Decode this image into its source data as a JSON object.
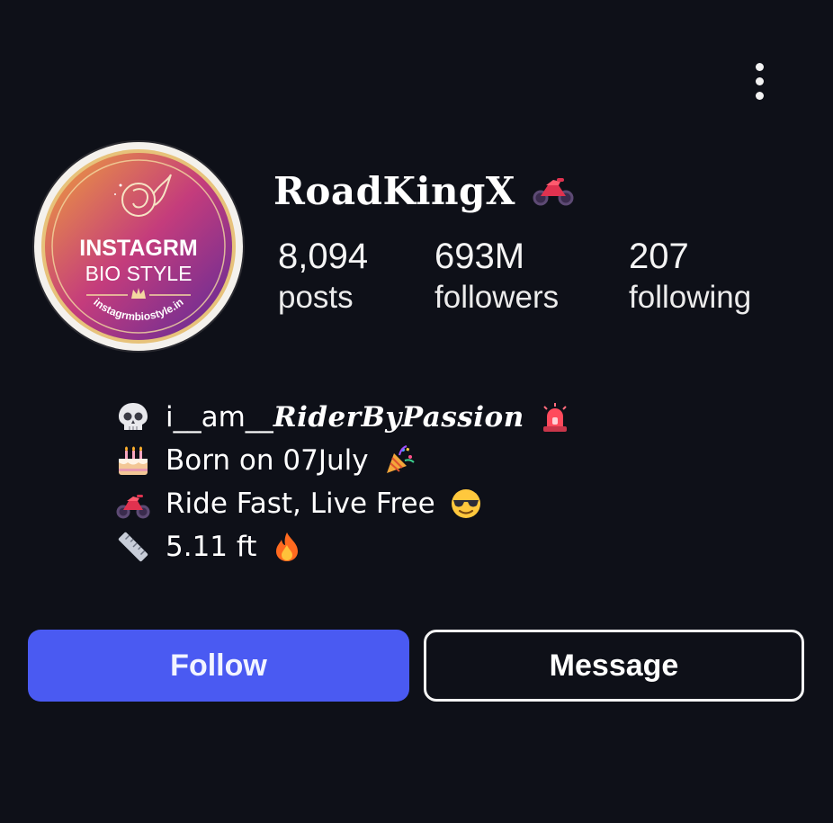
{
  "profile": {
    "username": "RoadKingX",
    "username_icon": "motorcycle-icon",
    "avatar": {
      "logo_line1": "INSTAGRM",
      "logo_line2": "BIO STYLE",
      "logo_url_text": "instagrmbiostyle.in",
      "colors": {
        "ring": "#f4f1ec",
        "gradient_start": "#f0a13a",
        "gradient_mid": "#c43c7c",
        "gradient_end": "#5a2a9a"
      }
    }
  },
  "stats": [
    {
      "value": "8,094",
      "label": "posts"
    },
    {
      "value": "693M",
      "label": "followers"
    },
    {
      "value": "207",
      "label": "following"
    }
  ],
  "bio": {
    "lines": [
      {
        "lead_icon": "skull-icon",
        "prefix": "i__am__",
        "emphasis": "RiderByPassion",
        "trail_icon": "siren-icon"
      },
      {
        "lead_icon": "birthday-cake-icon",
        "text": "Born on 07July",
        "trail_icon": "party-popper-icon"
      },
      {
        "lead_icon": "motorcycle-icon",
        "text": "Ride Fast, Live Free",
        "trail_icon": "cool-sunglasses-face-icon"
      },
      {
        "lead_icon": "ruler-icon",
        "text": "5.11 ft",
        "trail_icon": "fire-icon"
      }
    ]
  },
  "actions": {
    "follow_label": "Follow",
    "message_label": "Message",
    "more_icon": "more-vertical-icon"
  },
  "colors": {
    "background": "#0e1018",
    "follow_button": "#4a5af2",
    "text": "#ffffff"
  }
}
